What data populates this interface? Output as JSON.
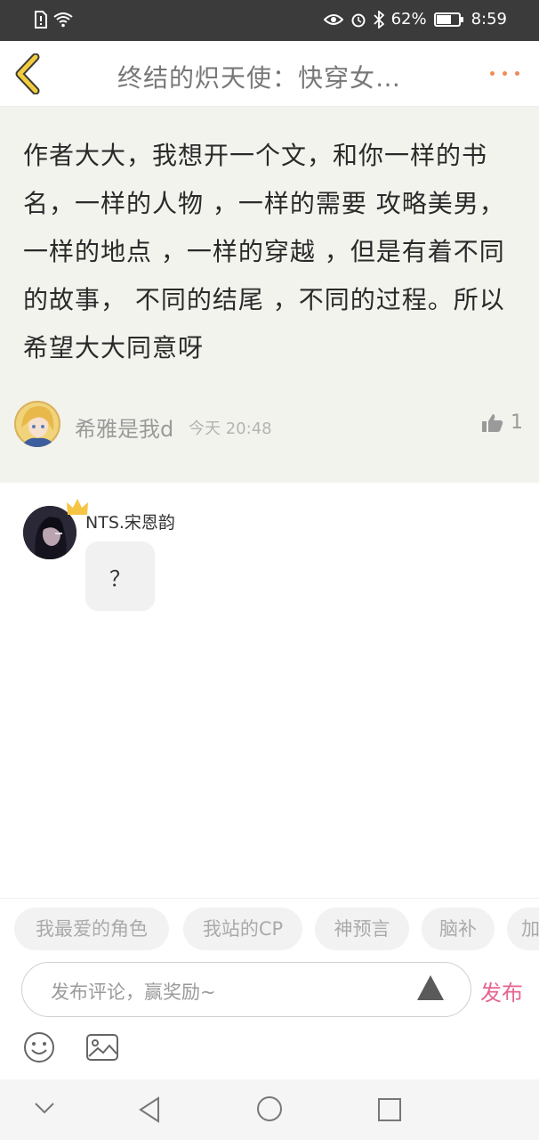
{
  "status_bar": {
    "battery": "62%",
    "time": "8:59"
  },
  "header": {
    "title": "终结的炽天使：快穿女…"
  },
  "post": {
    "text": "作者大大，我想开一个文，和你一样的书名，一样的人物 ，一样的需要 攻略美男，一样的地点 ，一样的穿越 ，但是有着不同的故事， 不同的结尾 ，不同的过程。所以希望大大同意呀",
    "author_name": "希雅是我d",
    "time": "今天 20:48",
    "likes": "1"
  },
  "reply": {
    "author_name": "NTS.宋恩韵",
    "text": "？"
  },
  "tags": [
    "我最爱的角色",
    "我站的CP",
    "神预言",
    "脑补",
    "加"
  ],
  "comment": {
    "placeholder": "发布评论，赢奖励~",
    "publish_label": "发布"
  },
  "colors": {
    "accent_pink": "#e4668e",
    "more_orange": "#f08a5a",
    "back_yellow": "#f2cc3c",
    "post_bg": "#f3f3ee"
  }
}
